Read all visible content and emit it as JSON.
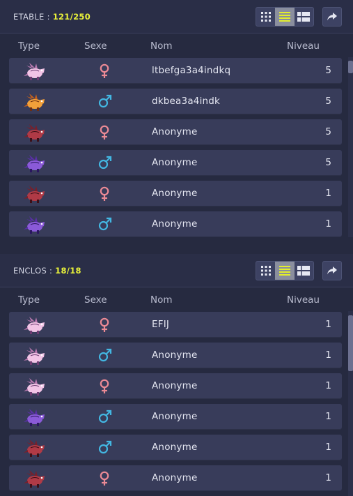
{
  "columns": {
    "type": "Type",
    "sex": "Sexe",
    "name": "Nom",
    "level": "Niveau"
  },
  "colors": {
    "female": "#ec8a95",
    "male": "#43b7e2",
    "accent_count": "#e9f23a",
    "row_bg": "#383c5a",
    "panel_bg": "#262a40"
  },
  "panels": [
    {
      "label": "ETABLE : ",
      "count": "121/250",
      "active_view": "list",
      "views": [
        "grid-view-icon",
        "list-view-icon",
        "detail-view-icon"
      ],
      "rows": [
        {
          "type_icon": "dragon-pink-icon",
          "sex": "female",
          "sex_icon": "female-icon",
          "name": "ltbefga3a4indkq",
          "level": "5"
        },
        {
          "type_icon": "dragon-orange-icon",
          "sex": "male",
          "sex_icon": "male-icon",
          "name": "dkbea3a4indk",
          "level": "5"
        },
        {
          "type_icon": "dragon-red-icon",
          "sex": "female",
          "sex_icon": "female-icon",
          "name": "Anonyme",
          "level": "5"
        },
        {
          "type_icon": "dragon-purple-icon",
          "sex": "male",
          "sex_icon": "male-icon",
          "name": "Anonyme",
          "level": "5"
        },
        {
          "type_icon": "dragon-red-icon",
          "sex": "female",
          "sex_icon": "female-icon",
          "name": "Anonyme",
          "level": "1"
        },
        {
          "type_icon": "dragon-purple-icon",
          "sex": "male",
          "sex_icon": "male-icon",
          "name": "Anonyme",
          "level": "1"
        }
      ]
    },
    {
      "label": "ENCLOS : ",
      "count": "18/18",
      "active_view": "list",
      "views": [
        "grid-view-icon",
        "list-view-icon",
        "detail-view-icon"
      ],
      "rows": [
        {
          "type_icon": "dragon-pink-icon",
          "sex": "female",
          "sex_icon": "female-icon",
          "name": "EFIJ",
          "level": "1"
        },
        {
          "type_icon": "dragon-pink-icon",
          "sex": "male",
          "sex_icon": "male-icon",
          "name": "Anonyme",
          "level": "1"
        },
        {
          "type_icon": "dragon-pink-icon",
          "sex": "female",
          "sex_icon": "female-icon",
          "name": "Anonyme",
          "level": "1"
        },
        {
          "type_icon": "dragon-purple-icon",
          "sex": "male",
          "sex_icon": "male-icon",
          "name": "Anonyme",
          "level": "1"
        },
        {
          "type_icon": "dragon-red-icon",
          "sex": "male",
          "sex_icon": "male-icon",
          "name": "Anonyme",
          "level": "1"
        },
        {
          "type_icon": "dragon-red-icon",
          "sex": "female",
          "sex_icon": "female-icon",
          "name": "Anonyme",
          "level": "1"
        }
      ]
    }
  ]
}
